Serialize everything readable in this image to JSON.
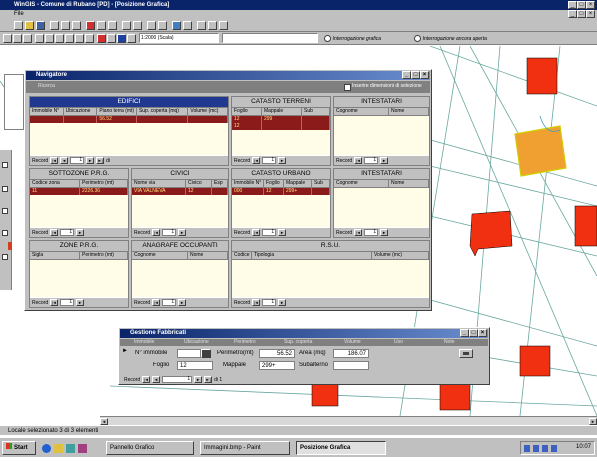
{
  "app": {
    "title": "WinGIS - Comune di Rubano [PD] - [Posizione Grafica]",
    "menu_label": "File",
    "status_text": "Locale selezionato 3 di 3 elementi",
    "scale_dropdown": "1:2000 (Scala)",
    "radio_options": [
      "Interrogazione grafica",
      "Interrogazione ancora aperta"
    ]
  },
  "navigator": {
    "title": "Navigatore",
    "subtitle": "Ricerca",
    "checkbox_label": "Inserire dimensioni di selezione",
    "panels": {
      "edifici": {
        "title": "EDIFICI",
        "columns": [
          "Immobile N°",
          "Ubicazione",
          "Piano terra (mt)",
          "Sup. coperta (mq)",
          "Volume (mc)"
        ],
        "row": [
          "",
          "",
          "56.52",
          "",
          ""
        ]
      },
      "catasto_terreni": {
        "title": "CATASTO TERRENI",
        "columns": [
          "Foglio",
          "Mappale",
          "Sub"
        ],
        "rows": [
          [
            "12",
            "299",
            ""
          ],
          [
            "12",
            "",
            ""
          ]
        ]
      },
      "intestatari_1": {
        "title": "INTESTATARI",
        "columns": [
          "Cognome",
          "Nome"
        ]
      },
      "sottozone": {
        "title": "SOTTOZONE P.R.G.",
        "columns": [
          "Codice zona",
          "Perimetro (mt)"
        ],
        "row": [
          "11",
          "2226.36"
        ]
      },
      "civici": {
        "title": "CIVICI",
        "columns": [
          "Nome via",
          "Civico",
          "Esp"
        ],
        "row": [
          "VIA VALNEVA",
          "12",
          ""
        ]
      },
      "catasto_urbano": {
        "title": "CATASTO URBANO",
        "columns": [
          "Immobile N°",
          "Foglio",
          "Mappale",
          "Sub"
        ],
        "row": [
          "000",
          "12",
          "299+",
          ""
        ]
      },
      "intestatari_2": {
        "title": "INTESTATARI",
        "columns": [
          "Cognome",
          "Nome"
        ]
      },
      "zone_prg": {
        "title": "ZONE P.R.G.",
        "columns": [
          "Sigla",
          "Perimetro (mt)"
        ]
      },
      "anagrafe": {
        "title": "ANAGRAFE OCCUPANTI",
        "columns": [
          "Cognome",
          "Nome"
        ]
      },
      "rsu": {
        "title": "R.S.U.",
        "columns": [
          "Codice",
          "Tipologia",
          "Volume (mc)"
        ]
      }
    },
    "nav": {
      "label": "Record",
      "values": [
        "1",
        "1",
        "1",
        "1",
        "1",
        "1",
        "1",
        "1",
        "1",
        "1"
      ],
      "of_label": "di"
    }
  },
  "edifici_form": {
    "title": "Gestione Fabbricati",
    "header_cols": [
      "Immobile",
      "Ubicazione",
      "Perimetro",
      "Sup. coperta",
      "Volume",
      "Uso",
      "Note"
    ],
    "labels": {
      "immobile": "N° immobile",
      "perimetro": "Perimetro(mt)",
      "area": "Area (mq)",
      "foglio": "Foglio",
      "mappale": "Mappale",
      "subalterno": "Subalterno"
    },
    "values": {
      "immobile": "",
      "perimetro": "56.52",
      "area": "186.07",
      "foglio": "12",
      "mappale": "299+",
      "subalterno": ""
    },
    "record_label": "Record",
    "record_value": "1",
    "record_of": "di 1"
  },
  "taskbar": {
    "start": "Start",
    "buttons": [
      "Pannello Grafico",
      "Immagini.bmp - Paint",
      "Posizione Grafica"
    ],
    "clock": "10:07"
  },
  "colors": {
    "map_bg": "#ffffff",
    "parcel_line": "#6aa8a0",
    "building_fill": "#f03010",
    "building_selected": "#f0a030",
    "title_blue": "#0a246a",
    "row_red": "#8b1a1a"
  }
}
